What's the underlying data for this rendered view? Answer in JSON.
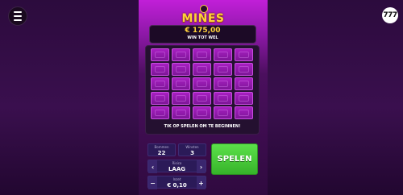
{
  "header": {
    "menu_icon": "hamburger-icon",
    "brand_badge": "777",
    "logo_text": "MINES"
  },
  "win": {
    "amount": "€ 175,00",
    "label": "WIN TOT WEL"
  },
  "grid": {
    "rows": 5,
    "cols": 5,
    "hint": "TIK OP SPELEN OM TE BEGINNEN!"
  },
  "controls": {
    "bombs": {
      "label": "Bommen",
      "value": "22"
    },
    "winnings": {
      "label": "Winsten",
      "value": "3"
    },
    "risk": {
      "label": "Risico",
      "value": "LAAG",
      "minus": "‹",
      "plus": "›"
    },
    "bet": {
      "label": "Inzet",
      "value": "€ 0,10",
      "minus": "−",
      "plus": "+"
    }
  },
  "play_button": {
    "label": "SPELEN"
  },
  "colors": {
    "accent": "#ffd23a",
    "tile": "#a81fc2",
    "play": "#36b32a"
  }
}
